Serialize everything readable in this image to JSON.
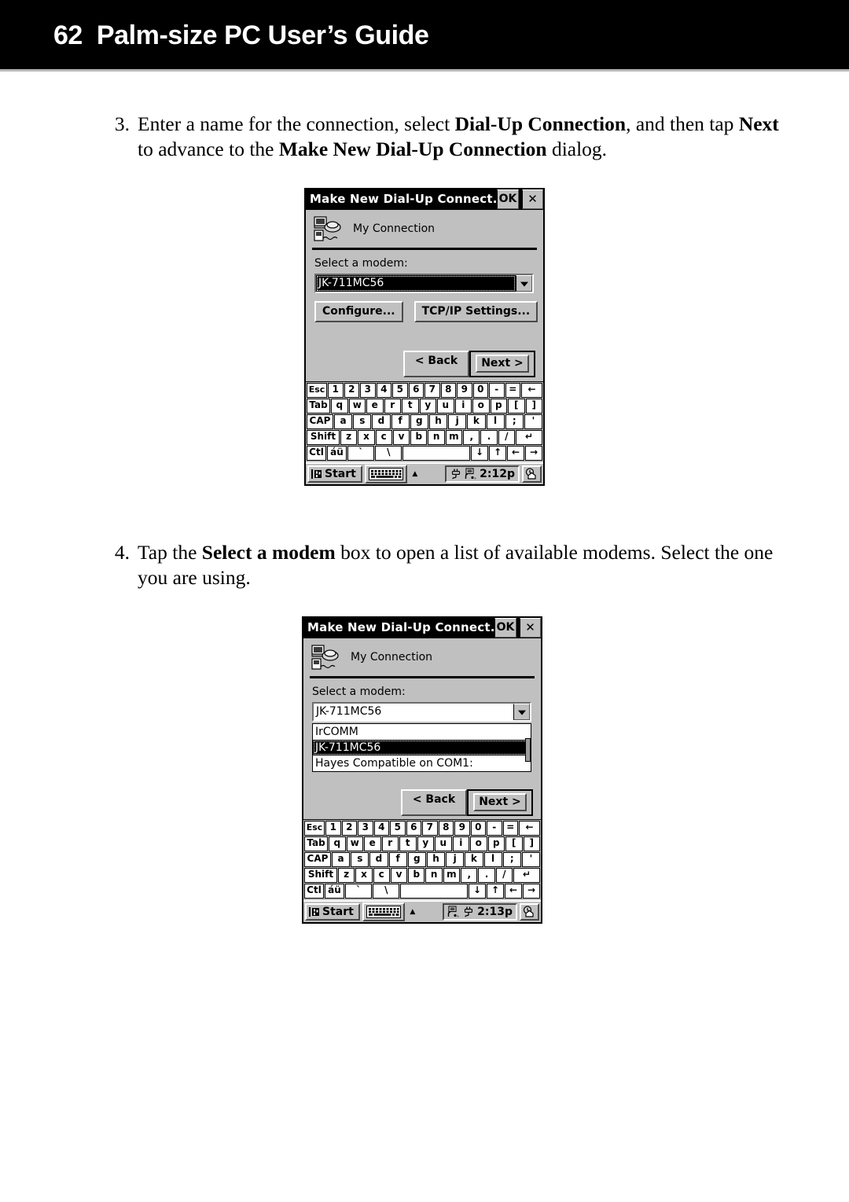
{
  "header": {
    "page_number": "62",
    "title": "Palm-size PC User’s Guide"
  },
  "steps": [
    {
      "number": "3.",
      "segments": [
        {
          "text": "Enter a name for the connection, select ",
          "bold": false
        },
        {
          "text": "Dial-Up Connection",
          "bold": true
        },
        {
          "text": ", and then tap ",
          "bold": false
        },
        {
          "text": "Next",
          "bold": true
        },
        {
          "text": " to advance to the ",
          "bold": false
        },
        {
          "text": "Make New Dial-Up Connection",
          "bold": true
        },
        {
          "text": " dialog.",
          "bold": false
        }
      ]
    },
    {
      "number": "4.",
      "segments": [
        {
          "text": "Tap the ",
          "bold": false
        },
        {
          "text": "Select a modem",
          "bold": true
        },
        {
          "text": " box to open a list of available modems. Select the one you are using.",
          "bold": false
        }
      ]
    }
  ],
  "screenshot1": {
    "titlebar": {
      "title": "Make New Dial-Up Connect...",
      "ok_label": "OK",
      "close_label": "✕"
    },
    "connection_name": "My Connection",
    "field_label": "Select a modem:",
    "combo_value": "JK-711MC56",
    "combo_selected": true,
    "buttons": {
      "configure": "Configure...",
      "tcpip": "TCP/IP Settings..."
    },
    "nav": {
      "back": "< Back",
      "next": "Next >"
    },
    "taskbar": {
      "start_label": "Start",
      "clock": "2:12p"
    }
  },
  "screenshot2": {
    "titlebar": {
      "title": "Make New Dial-Up Connect...",
      "ok_label": "OK",
      "close_label": "✕"
    },
    "connection_name": "My Connection",
    "field_label": "Select a modem:",
    "combo_value": "JK-711MC56",
    "combo_selected": false,
    "dropdown_options": [
      {
        "label": "IrCOMM",
        "selected": false
      },
      {
        "label": "JK-711MC56",
        "selected": true
      },
      {
        "label": "Hayes Compatible on COM1:",
        "selected": false
      }
    ],
    "nav": {
      "back": "< Back",
      "next": "Next >"
    },
    "taskbar": {
      "start_label": "Start",
      "clock": "2:13p"
    }
  },
  "keyboard": {
    "row1": [
      "Esc",
      "1",
      "2",
      "3",
      "4",
      "5",
      "6",
      "7",
      "8",
      "9",
      "0",
      "-",
      "=",
      "←"
    ],
    "row2": [
      "Tab",
      "q",
      "w",
      "e",
      "r",
      "t",
      "y",
      "u",
      "i",
      "o",
      "p",
      "[",
      "]"
    ],
    "row3": [
      "CAP",
      "a",
      "s",
      "d",
      "f",
      "g",
      "h",
      "j",
      "k",
      "l",
      ";",
      "'"
    ],
    "row4": [
      "Shift",
      "z",
      "x",
      "c",
      "v",
      "b",
      "n",
      "m",
      ",",
      ".",
      "/",
      "↵"
    ],
    "row5": [
      "Ctl",
      "áü",
      "`",
      "\\",
      " ",
      "↓",
      "↑",
      "←",
      "→"
    ]
  },
  "colors": {
    "header_band": "#000000",
    "dialog_face": "#c0c0c0",
    "titlebar": "#000000",
    "selection": "#000000",
    "page_background": "#ffffff"
  }
}
